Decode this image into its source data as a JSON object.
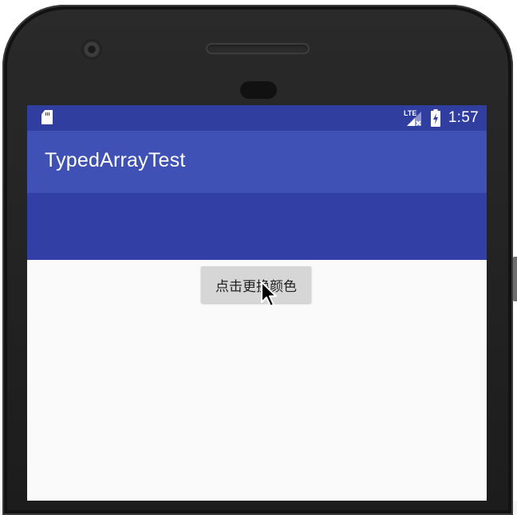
{
  "status_bar": {
    "network_label": "LTE",
    "time": "1:57",
    "icons": [
      "sd-card-icon",
      "cell-signal-icon",
      "battery-charging-icon"
    ]
  },
  "app_bar": {
    "title": "TypedArrayTest"
  },
  "main": {
    "change_color_button_label": "点击更换颜色"
  },
  "colors": {
    "primary": "#3f51b5",
    "primary_dark": "#303f9f",
    "changed_band": "#3240a6",
    "background": "#fafafa",
    "button": "#d6d6d6"
  }
}
